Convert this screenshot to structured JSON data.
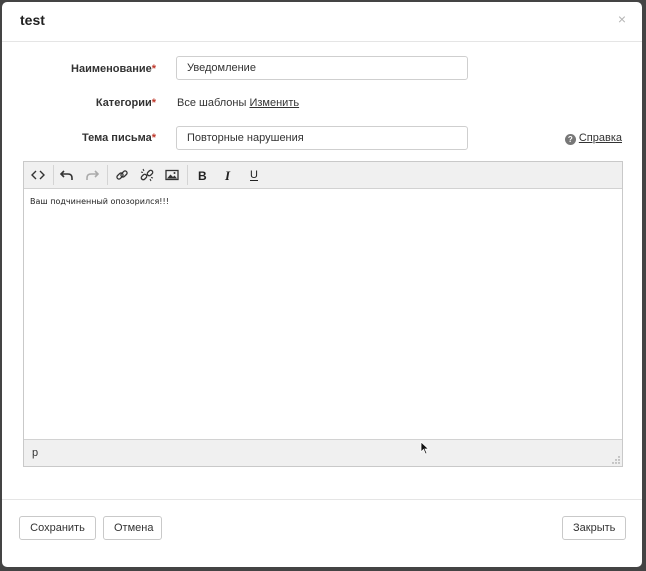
{
  "dialog": {
    "title": "test",
    "close_glyph": "×"
  },
  "form": {
    "name_label": "Наименование",
    "name_value": "Уведомление",
    "categories_label": "Категории",
    "categories_value": "Все шаблоны",
    "categories_change_link": "Изменить",
    "subject_label": "Тема письма",
    "subject_value": "Повторные нарушения",
    "required_mark": "*",
    "help_link": "Справка",
    "help_icon_glyph": "?"
  },
  "editor": {
    "toolbar": [
      {
        "name": "source-code-icon"
      },
      {
        "name": "undo-icon"
      },
      {
        "name": "redo-icon"
      },
      {
        "name": "link-icon"
      },
      {
        "name": "unlink-icon"
      },
      {
        "name": "image-icon"
      },
      {
        "name": "bold-icon"
      },
      {
        "name": "italic-icon"
      },
      {
        "name": "underline-icon"
      }
    ],
    "content": "Ваш подчиненный опозорился!!!",
    "path": "p"
  },
  "footer": {
    "save_label": "Сохранить",
    "cancel_label": "Отмена",
    "close_label": "Закрыть"
  },
  "colors": {
    "required": "#c0392b",
    "toolbar_bg": "#f0f0f0",
    "border": "#c9c9c9"
  }
}
